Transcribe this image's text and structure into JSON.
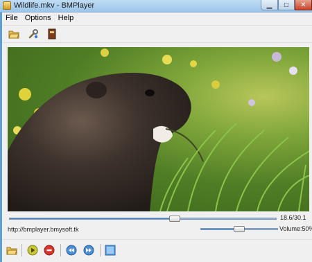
{
  "window": {
    "title": "Wildlife.mkv - BMPlayer"
  },
  "menu": {
    "items": [
      "File",
      "Options",
      "Help"
    ]
  },
  "toolbar": {
    "icons": [
      "open-folder-icon",
      "settings-wrench-icon",
      "book-icon"
    ]
  },
  "video": {
    "file": "Wildlife.mkv"
  },
  "playback": {
    "time_text": "18.6/30.1",
    "position": 18.6,
    "duration": 30.1
  },
  "footer": {
    "url": "http://bmplayer.bmysoft.tk"
  },
  "volume": {
    "text": "Volume:50%",
    "level": 50
  },
  "controls": {
    "icons": [
      "open-folder-icon",
      "play-icon",
      "stop-icon",
      "rewind-icon",
      "fast-forward-icon",
      "fullscreen-icon"
    ]
  },
  "colors": {
    "accent": "#4a87c4",
    "titlebar": "#9cc6ea",
    "close": "#c7422a"
  }
}
